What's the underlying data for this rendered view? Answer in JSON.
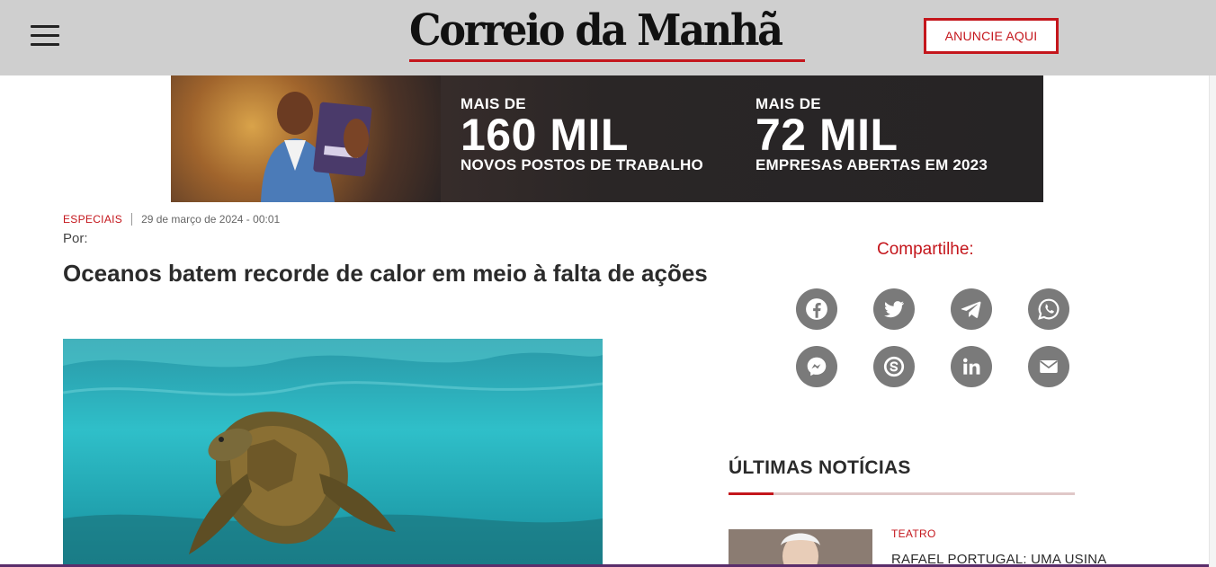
{
  "header": {
    "logo_text": "Correio da Manhã",
    "advertise_label": "ANUNCIE AQUI",
    "colors": {
      "bar": "#cfcfcf",
      "accent": "#c4161c"
    }
  },
  "banner": {
    "left_small": "MAIS DE",
    "left_big": "160 MIL",
    "left_sub": "NOVOS POSTOS DE TRABALHO",
    "right_small": "MAIS DE",
    "right_big": "72 MIL",
    "right_sub": "EMPRESAS ABERTAS EM 2023"
  },
  "article": {
    "category": "ESPECIAIS",
    "date": "29 de março de 2024 - 00:01",
    "byline": "Por:",
    "headline": "Oceanos batem recorde de calor em meio à falta de ações"
  },
  "share": {
    "title": "Compartilhe:",
    "buttons": [
      "facebook-icon",
      "twitter-icon",
      "telegram-icon",
      "whatsapp-icon",
      "messenger-icon",
      "skype-icon",
      "linkedin-icon",
      "email-icon"
    ]
  },
  "latest": {
    "title": "ÚLTIMAS NOTÍCIAS",
    "items": [
      {
        "category": "TEATRO",
        "title": "RAFAEL PORTUGAL: UMA USINA"
      }
    ]
  }
}
